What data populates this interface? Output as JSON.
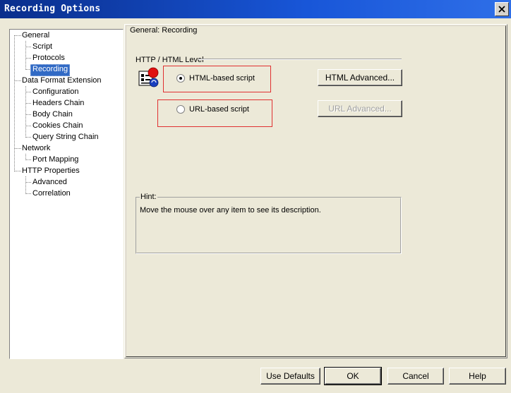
{
  "window": {
    "title": "Recording Options",
    "close_icon": "close-icon"
  },
  "tree": {
    "items": [
      {
        "label": "General"
      },
      {
        "label": "Script"
      },
      {
        "label": "Protocols"
      },
      {
        "label": "Recording",
        "selected": true
      },
      {
        "label": "Data Format Extension"
      },
      {
        "label": "Configuration"
      },
      {
        "label": "Headers Chain"
      },
      {
        "label": "Body Chain"
      },
      {
        "label": "Cookies Chain"
      },
      {
        "label": "Query String Chain"
      },
      {
        "label": "Network"
      },
      {
        "label": "Port Mapping"
      },
      {
        "label": "HTTP Properties"
      },
      {
        "label": "Advanced"
      },
      {
        "label": "Correlation"
      }
    ]
  },
  "main": {
    "section_title": "General: Recording",
    "group_title": "HTTP / HTML Level",
    "html_option": {
      "label": "HTML-based script",
      "checked": true
    },
    "url_option": {
      "label": "URL-based script",
      "checked": false
    },
    "html_advanced_button": "HTML Advanced...",
    "url_advanced_button": "URL Advanced...",
    "hint_title": "Hint:",
    "hint_text": "Move the mouse over any item to see its description.",
    "icon": "script-recording-icon"
  },
  "footer": {
    "use_defaults": "Use Defaults",
    "ok": "OK",
    "cancel": "Cancel",
    "help": "Help"
  },
  "colors": {
    "title_bar": "#0a2e8c",
    "selection": "#316ac5",
    "highlight_box": "#e03030",
    "dialog_bg": "#ece9d8"
  }
}
